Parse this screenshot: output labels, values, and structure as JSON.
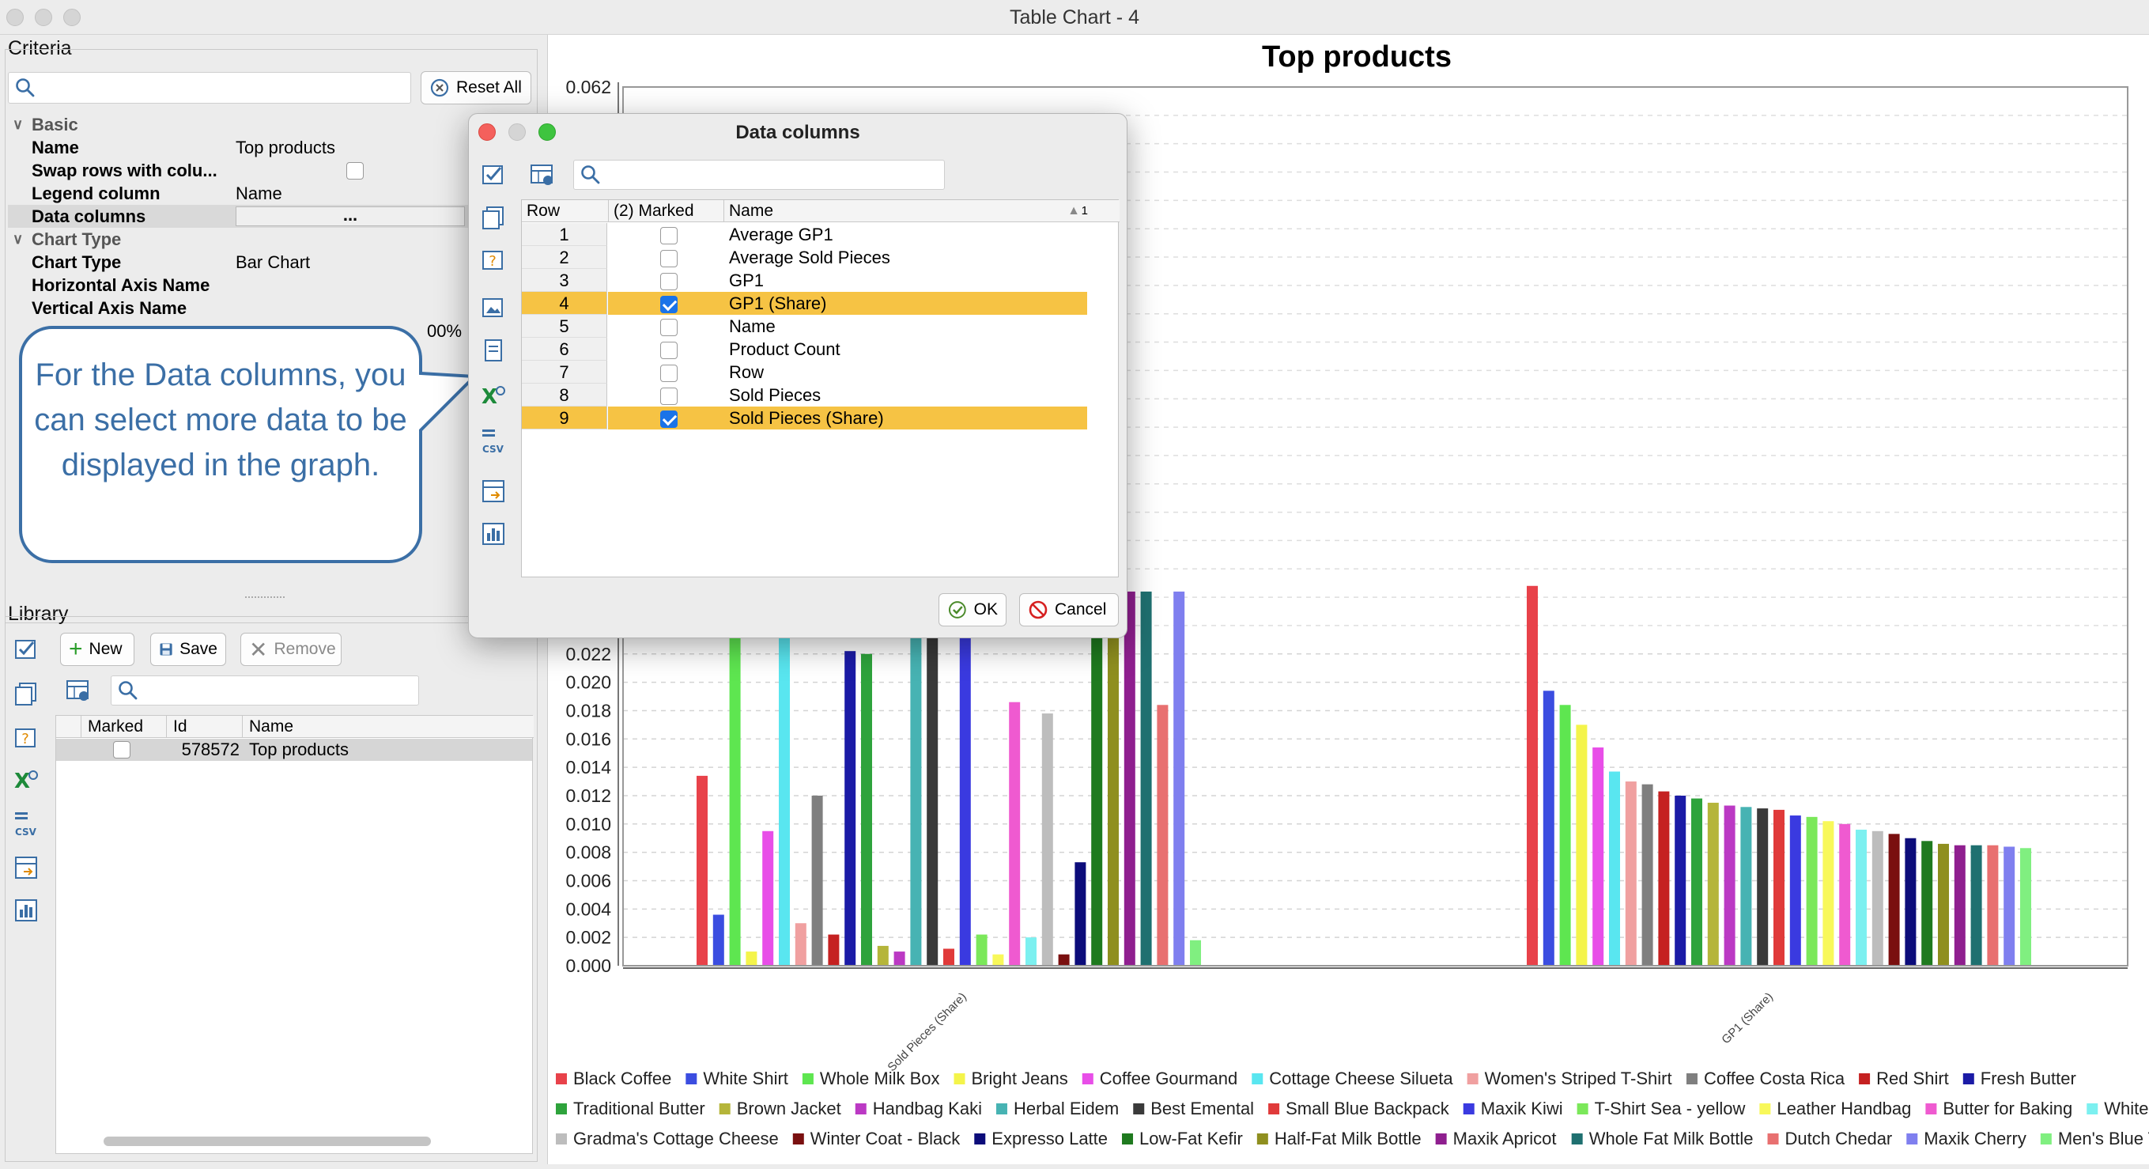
{
  "window": {
    "title": "Table Chart - 4"
  },
  "criteria": {
    "label": "Criteria",
    "reset_label": "Reset All",
    "categories": {
      "basic": "Basic",
      "chart_type": "Chart Type"
    },
    "props": {
      "name_k": "Name",
      "name_v": "Top products",
      "swap_k": "Swap rows with colu...",
      "legend_k": "Legend column",
      "legend_v": "Name",
      "datacols_k": "Data columns",
      "datacols_v": "...",
      "charttype_k": "Chart Type",
      "charttype_v": "Bar Chart",
      "haxis_k": "Horizontal Axis Name",
      "vaxis_k": "Vertical Axis Name",
      "partial_v": "00%"
    }
  },
  "library": {
    "label": "Library",
    "new_label": "New",
    "save_label": "Save",
    "remove_label": "Remove",
    "columns": [
      "Marked",
      "Id",
      "Name"
    ],
    "rows": [
      {
        "id": "578572",
        "name": "Top products"
      }
    ]
  },
  "callout": {
    "text": "For the Data columns, you can select more data to be displayed in the graph."
  },
  "dialog": {
    "title": "Data columns",
    "columns": {
      "row": "Row",
      "marked": "(2) Marked",
      "name": "Name",
      "sort_indicator": "1"
    },
    "rows": [
      {
        "row": "1",
        "name": "Average GP1",
        "marked": false
      },
      {
        "row": "2",
        "name": "Average Sold Pieces",
        "marked": false
      },
      {
        "row": "3",
        "name": "GP1",
        "marked": false
      },
      {
        "row": "4",
        "name": "GP1 (Share)",
        "marked": true
      },
      {
        "row": "5",
        "name": "Name",
        "marked": false
      },
      {
        "row": "6",
        "name": "Product Count",
        "marked": false
      },
      {
        "row": "7",
        "name": "Row",
        "marked": false
      },
      {
        "row": "8",
        "name": "Sold Pieces",
        "marked": false
      },
      {
        "row": "9",
        "name": "Sold Pieces (Share)",
        "marked": true
      }
    ],
    "ok_label": "OK",
    "cancel_label": "Cancel"
  },
  "chart_data": {
    "type": "bar",
    "title": "Top products",
    "categories": [
      "Sold Pieces (Share)",
      "GP1 (Share)"
    ],
    "ylim": [
      0,
      0.062
    ],
    "yticks": [
      "0.000",
      "0.002",
      "0.004",
      "0.006",
      "0.008",
      "0.010",
      "0.012",
      "0.014",
      "0.016",
      "0.018",
      "0.020",
      "0.022"
    ],
    "ytick_top": "0.062",
    "legend_placement": "bottom",
    "series": [
      {
        "name": "Black Coffee",
        "color": "#e8424a",
        "values": [
          0.0134,
          0.0268
        ]
      },
      {
        "name": "White Shirt",
        "color": "#3b4de0",
        "values": [
          0.0036,
          0.0194
        ]
      },
      {
        "name": "Whole Milk Box",
        "color": "#5ee650",
        "values": [
          0.0234,
          0.0184
        ]
      },
      {
        "name": "Bright Jeans",
        "color": "#f4f44a",
        "values": [
          0.001,
          0.017
        ]
      },
      {
        "name": "Coffee Gourmand",
        "color": "#e84ee8",
        "values": [
          0.0095,
          0.0154
        ]
      },
      {
        "name": "Cottage Cheese Silueta",
        "color": "#59e6f0",
        "values": [
          0.0234,
          0.0137
        ]
      },
      {
        "name": "Women's Striped T-Shirt",
        "color": "#f0a0a0",
        "values": [
          0.003,
          0.013
        ]
      },
      {
        "name": "Coffee Costa Rica",
        "color": "#7f7f7f",
        "values": [
          0.012,
          0.0128
        ]
      },
      {
        "name": "Red Shirt",
        "color": "#c52121",
        "values": [
          0.0022,
          0.0123
        ]
      },
      {
        "name": "Fresh Butter",
        "color": "#1b1ba6",
        "values": [
          0.0222,
          0.012
        ]
      },
      {
        "name": "Traditional Butter",
        "color": "#2ea33c",
        "values": [
          0.022,
          0.0118
        ]
      },
      {
        "name": "Brown Jacket",
        "color": "#b5b53a",
        "values": [
          0.0014,
          0.0115
        ]
      },
      {
        "name": "Handbag Kaki",
        "color": "#bb39c4",
        "values": [
          0.001,
          0.0113
        ]
      },
      {
        "name": "Herbal Eidem",
        "color": "#47b3b3",
        "values": [
          0.0234,
          0.0112
        ]
      },
      {
        "name": "Best Emental",
        "color": "#3a3a3a",
        "values": [
          0.0234,
          0.0111
        ]
      },
      {
        "name": "Small Blue Backpack",
        "color": "#e03a3a",
        "values": [
          0.0012,
          0.011
        ]
      },
      {
        "name": "Maxik Kiwi",
        "color": "#3a3ae0",
        "values": [
          0.0234,
          0.0106
        ]
      },
      {
        "name": "T-Shirt Sea - yellow",
        "color": "#7be85a",
        "values": [
          0.0022,
          0.0105
        ]
      },
      {
        "name": "Leather Handbag",
        "color": "#f8f85a",
        "values": [
          0.0008,
          0.0102
        ]
      },
      {
        "name": "Butter for Baking",
        "color": "#ef5ad0",
        "values": [
          0.0186,
          0.01
        ]
      },
      {
        "name": "White T-Shirt",
        "color": "#7cf0f0",
        "values": [
          0.002,
          0.0096
        ]
      },
      {
        "name": "Gradma's Cottage Cheese",
        "color": "#bdbdbd",
        "values": [
          0.0178,
          0.0095
        ]
      },
      {
        "name": "Winter Coat - Black",
        "color": "#7a1010",
        "values": [
          0.0008,
          0.0093
        ]
      },
      {
        "name": "Expresso Latte",
        "color": "#0c0c7a",
        "values": [
          0.0073,
          0.009
        ]
      },
      {
        "name": "Low-Fat Kefir",
        "color": "#1f7a1f",
        "values": [
          0.0266,
          0.0088
        ]
      },
      {
        "name": "Half-Fat Milk Bottle",
        "color": "#8f8f1f",
        "values": [
          0.0266,
          0.0086
        ]
      },
      {
        "name": "Maxik Apricot",
        "color": "#8f1f8f",
        "values": [
          0.0264,
          0.0085
        ]
      },
      {
        "name": "Whole Fat Milk Bottle",
        "color": "#1f7070",
        "values": [
          0.0264,
          0.0085
        ]
      },
      {
        "name": "Dutch Chedar",
        "color": "#e87070",
        "values": [
          0.0184,
          0.0085
        ]
      },
      {
        "name": "Maxik Cherry",
        "color": "#7f7fef",
        "values": [
          0.0264,
          0.0084
        ]
      },
      {
        "name": "Men's Blue T-shirt",
        "color": "#80ef80",
        "values": [
          0.0018,
          0.0083
        ]
      }
    ]
  }
}
